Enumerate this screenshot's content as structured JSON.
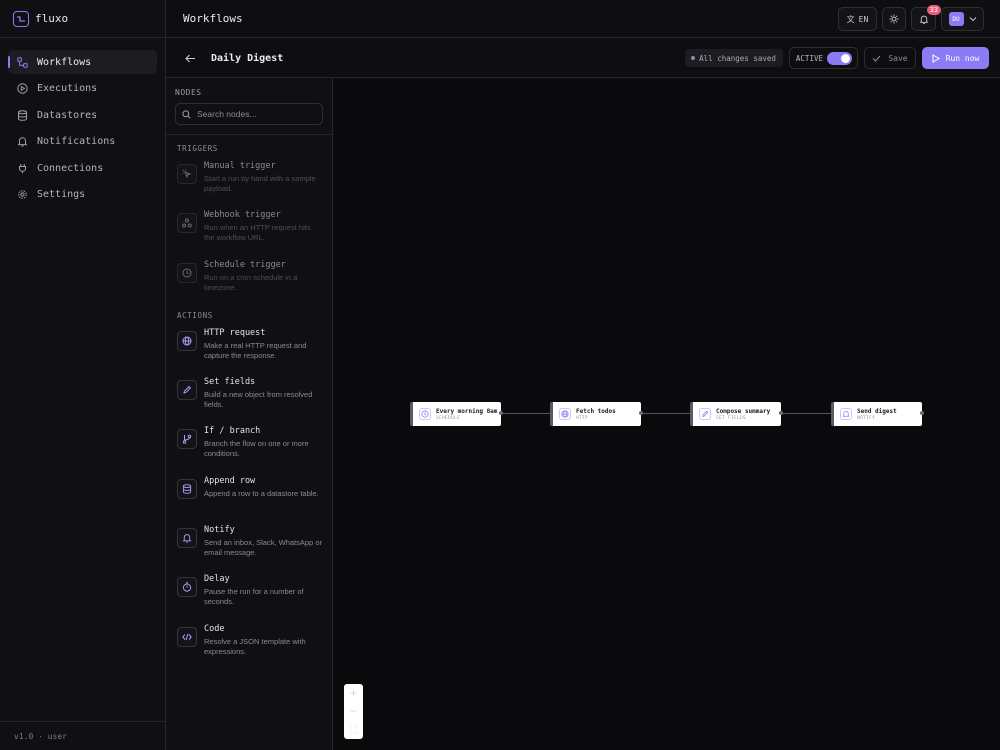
{
  "brand": {
    "name": "fluxo"
  },
  "sidebar": {
    "items": [
      {
        "label": "Workflows",
        "icon": "workflow-icon",
        "active": true
      },
      {
        "label": "Executions",
        "icon": "play-circle-icon"
      },
      {
        "label": "Datastores",
        "icon": "database-icon"
      },
      {
        "label": "Notifications",
        "icon": "bell-icon"
      },
      {
        "label": "Connections",
        "icon": "plug-icon"
      },
      {
        "label": "Settings",
        "icon": "gear-icon"
      }
    ],
    "footer": "v1.0 · user"
  },
  "header": {
    "title": "Workflows",
    "language": "EN",
    "notification_count": "33",
    "avatar_initials": "DU"
  },
  "workflow": {
    "title": "Daily Digest",
    "save_status": "All changes saved",
    "active_label": "ACTIVE",
    "active": true,
    "save_label": "Save",
    "run_label": "Run now"
  },
  "panel": {
    "title": "NODES",
    "search_placeholder": "Search nodes...",
    "triggers_label": "TRIGGERS",
    "triggers": [
      {
        "name": "Manual trigger",
        "desc": "Start a run by hand with a sample payload.",
        "icon": "cursor-click-icon"
      },
      {
        "name": "Webhook trigger",
        "desc": "Run when an HTTP request hits the workflow URL.",
        "icon": "webhook-icon"
      },
      {
        "name": "Schedule trigger",
        "desc": "Run on a cron schedule in a timezone.",
        "icon": "clock-icon"
      }
    ],
    "actions_label": "ACTIONS",
    "actions": [
      {
        "name": "HTTP request",
        "desc": "Make a real HTTP request and capture the response.",
        "icon": "globe-icon"
      },
      {
        "name": "Set fields",
        "desc": "Build a new object from resolved fields.",
        "icon": "pencil-icon"
      },
      {
        "name": "If / branch",
        "desc": "Branch the flow on one or more conditions.",
        "icon": "git-branch-icon"
      },
      {
        "name": "Append row",
        "desc": "Append a row to a datastore table.",
        "icon": "database-icon"
      },
      {
        "name": "Notify",
        "desc": "Send an inbox, Slack, WhatsApp or email message.",
        "icon": "bell-icon"
      },
      {
        "name": "Delay",
        "desc": "Pause the run for a number of seconds.",
        "icon": "timer-icon"
      },
      {
        "name": "Code",
        "desc": "Resolve a JSON template with expressions.",
        "icon": "code-icon"
      }
    ]
  },
  "canvas": {
    "nodes": [
      {
        "title": "Every morning 8am",
        "type": "SCHEDULE",
        "icon": "clock-icon"
      },
      {
        "title": "Fetch todos",
        "type": "HTTP",
        "icon": "globe-icon"
      },
      {
        "title": "Compose summary",
        "type": "SET FIELDS",
        "icon": "pencil-icon"
      },
      {
        "title": "Send digest",
        "type": "NOTIFY",
        "icon": "bell-icon"
      }
    ],
    "zoom_in": "+",
    "zoom_out": "−",
    "fit": "⛶"
  },
  "colors": {
    "accent": "#8b7cf6",
    "badge": "#e85d7a",
    "background": "#0e0e11"
  }
}
